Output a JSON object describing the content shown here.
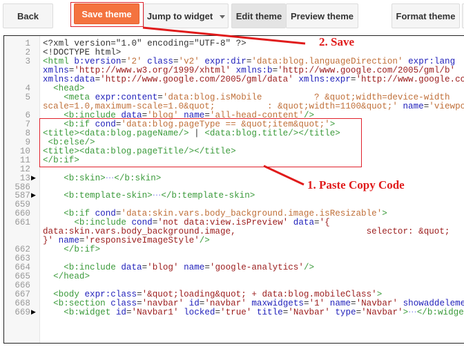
{
  "toolbar": {
    "back": "Back",
    "save": "Save theme",
    "jump": "Jump to widget",
    "edit": "Edit theme",
    "preview": "Preview theme",
    "format": "Format theme"
  },
  "colors": {
    "accent": "#f4733f",
    "annotation": "#e01b1b"
  },
  "annotations": {
    "save_note": "2.  Save",
    "paste_note": "1. Paste Copy Code"
  },
  "code_lines": [
    {
      "num": "1",
      "seg": [
        [
          "p",
          "<?xml version=\"1.0\" encoding=\"UTF-8\" ?>"
        ]
      ]
    },
    {
      "num": "2",
      "seg": [
        [
          "p",
          "<!DOCTYPE html>"
        ]
      ]
    },
    {
      "num": "3",
      "seg": [
        [
          "t",
          "<html"
        ],
        [
          "a",
          " b:version"
        ],
        [
          "p",
          "="
        ],
        [
          "v",
          "'2'"
        ],
        [
          "a",
          " class"
        ],
        [
          "p",
          "="
        ],
        [
          "v",
          "'v2'"
        ],
        [
          "a",
          " expr:dir"
        ],
        [
          "p",
          "="
        ],
        [
          "v",
          "'data:blog.languageDirection'"
        ],
        [
          "a",
          " expr:lang"
        ]
      ]
    },
    {
      "num": "",
      "seg": [
        [
          "a",
          "xmlns"
        ],
        [
          "p",
          "="
        ],
        [
          "s",
          "'http://www.w3.org/1999/xhtml'"
        ],
        [
          "a",
          " xmlns:b"
        ],
        [
          "p",
          "="
        ],
        [
          "s",
          "'http://www.google.com/2005/gml/b'"
        ]
      ]
    },
    {
      "num": "",
      "seg": [
        [
          "a",
          "xmlns:data"
        ],
        [
          "p",
          "="
        ],
        [
          "s",
          "'http://www.google.com/2005/gml/data'"
        ],
        [
          "a",
          " xmlns:expr"
        ],
        [
          "p",
          "="
        ],
        [
          "s",
          "'http://www.google.com'"
        ]
      ]
    },
    {
      "num": "4",
      "seg": [
        [
          "p",
          "  "
        ],
        [
          "t",
          "<head>"
        ]
      ]
    },
    {
      "num": "5",
      "seg": [
        [
          "p",
          "    "
        ],
        [
          "t",
          "<meta"
        ],
        [
          "a",
          " expr:content"
        ],
        [
          "p",
          "="
        ],
        [
          "v",
          "'data:blog.isMobile          ? &quot;width=device-width"
        ]
      ]
    },
    {
      "num": "",
      "seg": [
        [
          "v",
          "scale=1.0,maximum-scale=1.0&quot;          : &quot;width=1100&quot;'"
        ],
        [
          "a",
          " name"
        ],
        [
          "p",
          "="
        ],
        [
          "v",
          "'viewport'"
        ]
      ]
    },
    {
      "num": "6",
      "seg": [
        [
          "p",
          "    "
        ],
        [
          "t",
          "<b:include"
        ],
        [
          "a",
          " data"
        ],
        [
          "p",
          "="
        ],
        [
          "v",
          "'blog'"
        ],
        [
          "a",
          " name"
        ],
        [
          "p",
          "="
        ],
        [
          "v",
          "'all-head-content'"
        ],
        [
          "t",
          "/>"
        ]
      ]
    },
    {
      "num": "7",
      "seg": [
        [
          "p",
          "    "
        ],
        [
          "t",
          "<b:if"
        ],
        [
          "a",
          " cond"
        ],
        [
          "p",
          "="
        ],
        [
          "v",
          "'data:blog.pageType == &quot;item&quot;'"
        ],
        [
          "t",
          ">"
        ]
      ]
    },
    {
      "num": "8",
      "seg": [
        [
          "t",
          "<title><data:blog.pageName/>"
        ],
        [
          "p",
          " | "
        ],
        [
          "t",
          "<data:blog.title/></title>"
        ]
      ]
    },
    {
      "num": "9",
      "seg": [
        [
          "t",
          " <b:else/>"
        ]
      ]
    },
    {
      "num": "10",
      "seg": [
        [
          "t",
          "<title><data:blog.pageTitle/></title>"
        ]
      ]
    },
    {
      "num": "11",
      "seg": [
        [
          "t",
          "</b:if>"
        ]
      ]
    },
    {
      "num": "12",
      "seg": []
    },
    {
      "num": "13",
      "arrow": true,
      "seg": [
        [
          "p",
          "    "
        ],
        [
          "t",
          "<b:skin>"
        ],
        [
          "e",
          "⋯"
        ],
        [
          "t",
          "</b:skin>"
        ]
      ]
    },
    {
      "num": "586",
      "seg": []
    },
    {
      "num": "587",
      "arrow": true,
      "seg": [
        [
          "p",
          "    "
        ],
        [
          "t",
          "<b:template-skin>"
        ],
        [
          "e",
          "⋯"
        ],
        [
          "t",
          "</b:template-skin>"
        ]
      ]
    },
    {
      "num": "659",
      "seg": []
    },
    {
      "num": "660",
      "seg": [
        [
          "p",
          "    "
        ],
        [
          "t",
          "<b:if"
        ],
        [
          "a",
          " cond"
        ],
        [
          "p",
          "="
        ],
        [
          "v",
          "'data:skin.vars.body_background.image.isResizable'"
        ],
        [
          "t",
          ">"
        ]
      ]
    },
    {
      "num": "661",
      "seg": [
        [
          "p",
          "      "
        ],
        [
          "t",
          "<b:include"
        ],
        [
          "a",
          " cond"
        ],
        [
          "p",
          "="
        ],
        [
          "s",
          "'not data:view.isPreview'"
        ],
        [
          "a",
          " data"
        ],
        [
          "p",
          "="
        ],
        [
          "s",
          "'{"
        ]
      ]
    },
    {
      "num": "",
      "seg": [
        [
          "s",
          "data:skin.vars.body_background.image,                         selector: &quot;"
        ]
      ]
    },
    {
      "num": "",
      "seg": [
        [
          "s",
          "}'"
        ],
        [
          "a",
          " name"
        ],
        [
          "p",
          "="
        ],
        [
          "s",
          "'responsiveImageStyle'"
        ],
        [
          "t",
          "/>"
        ]
      ]
    },
    {
      "num": "662",
      "seg": [
        [
          "p",
          "    "
        ],
        [
          "t",
          "</b:if>"
        ]
      ]
    },
    {
      "num": "663",
      "seg": []
    },
    {
      "num": "664",
      "seg": [
        [
          "p",
          "    "
        ],
        [
          "t",
          "<b:include"
        ],
        [
          "a",
          " data"
        ],
        [
          "p",
          "="
        ],
        [
          "s",
          "'blog'"
        ],
        [
          "a",
          " name"
        ],
        [
          "p",
          "="
        ],
        [
          "s",
          "'google-analytics'"
        ],
        [
          "t",
          "/>"
        ]
      ]
    },
    {
      "num": "665",
      "seg": [
        [
          "p",
          "  "
        ],
        [
          "t",
          "</head>"
        ]
      ]
    },
    {
      "num": "666",
      "seg": []
    },
    {
      "num": "667",
      "seg": [
        [
          "p",
          "  "
        ],
        [
          "t",
          "<body"
        ],
        [
          "a",
          " expr:class"
        ],
        [
          "p",
          "="
        ],
        [
          "s",
          "'&quot;loading&quot; + data:blog.mobileClass'"
        ],
        [
          "t",
          ">"
        ]
      ]
    },
    {
      "num": "668",
      "seg": [
        [
          "p",
          "  "
        ],
        [
          "t",
          "<b:section"
        ],
        [
          "a",
          " class"
        ],
        [
          "p",
          "="
        ],
        [
          "s",
          "'navbar'"
        ],
        [
          "a",
          " id"
        ],
        [
          "p",
          "="
        ],
        [
          "s",
          "'navbar'"
        ],
        [
          "a",
          " maxwidgets"
        ],
        [
          "p",
          "="
        ],
        [
          "s",
          "'1'"
        ],
        [
          "a",
          " name"
        ],
        [
          "p",
          "="
        ],
        [
          "s",
          "'Navbar'"
        ],
        [
          "a",
          " showaddelement"
        ]
      ]
    },
    {
      "num": "669",
      "arrow": true,
      "seg": [
        [
          "p",
          "    "
        ],
        [
          "t",
          "<b:widget"
        ],
        [
          "a",
          " id"
        ],
        [
          "p",
          "="
        ],
        [
          "s",
          "'Navbar1'"
        ],
        [
          "a",
          " locked"
        ],
        [
          "p",
          "="
        ],
        [
          "s",
          "'true'"
        ],
        [
          "a",
          " title"
        ],
        [
          "p",
          "="
        ],
        [
          "s",
          "'Navbar'"
        ],
        [
          "a",
          " type"
        ],
        [
          "p",
          "="
        ],
        [
          "s",
          "'Navbar'"
        ],
        [
          "t",
          ">"
        ],
        [
          "e",
          "⋯"
        ],
        [
          "t",
          "</b:widget>"
        ]
      ]
    }
  ]
}
